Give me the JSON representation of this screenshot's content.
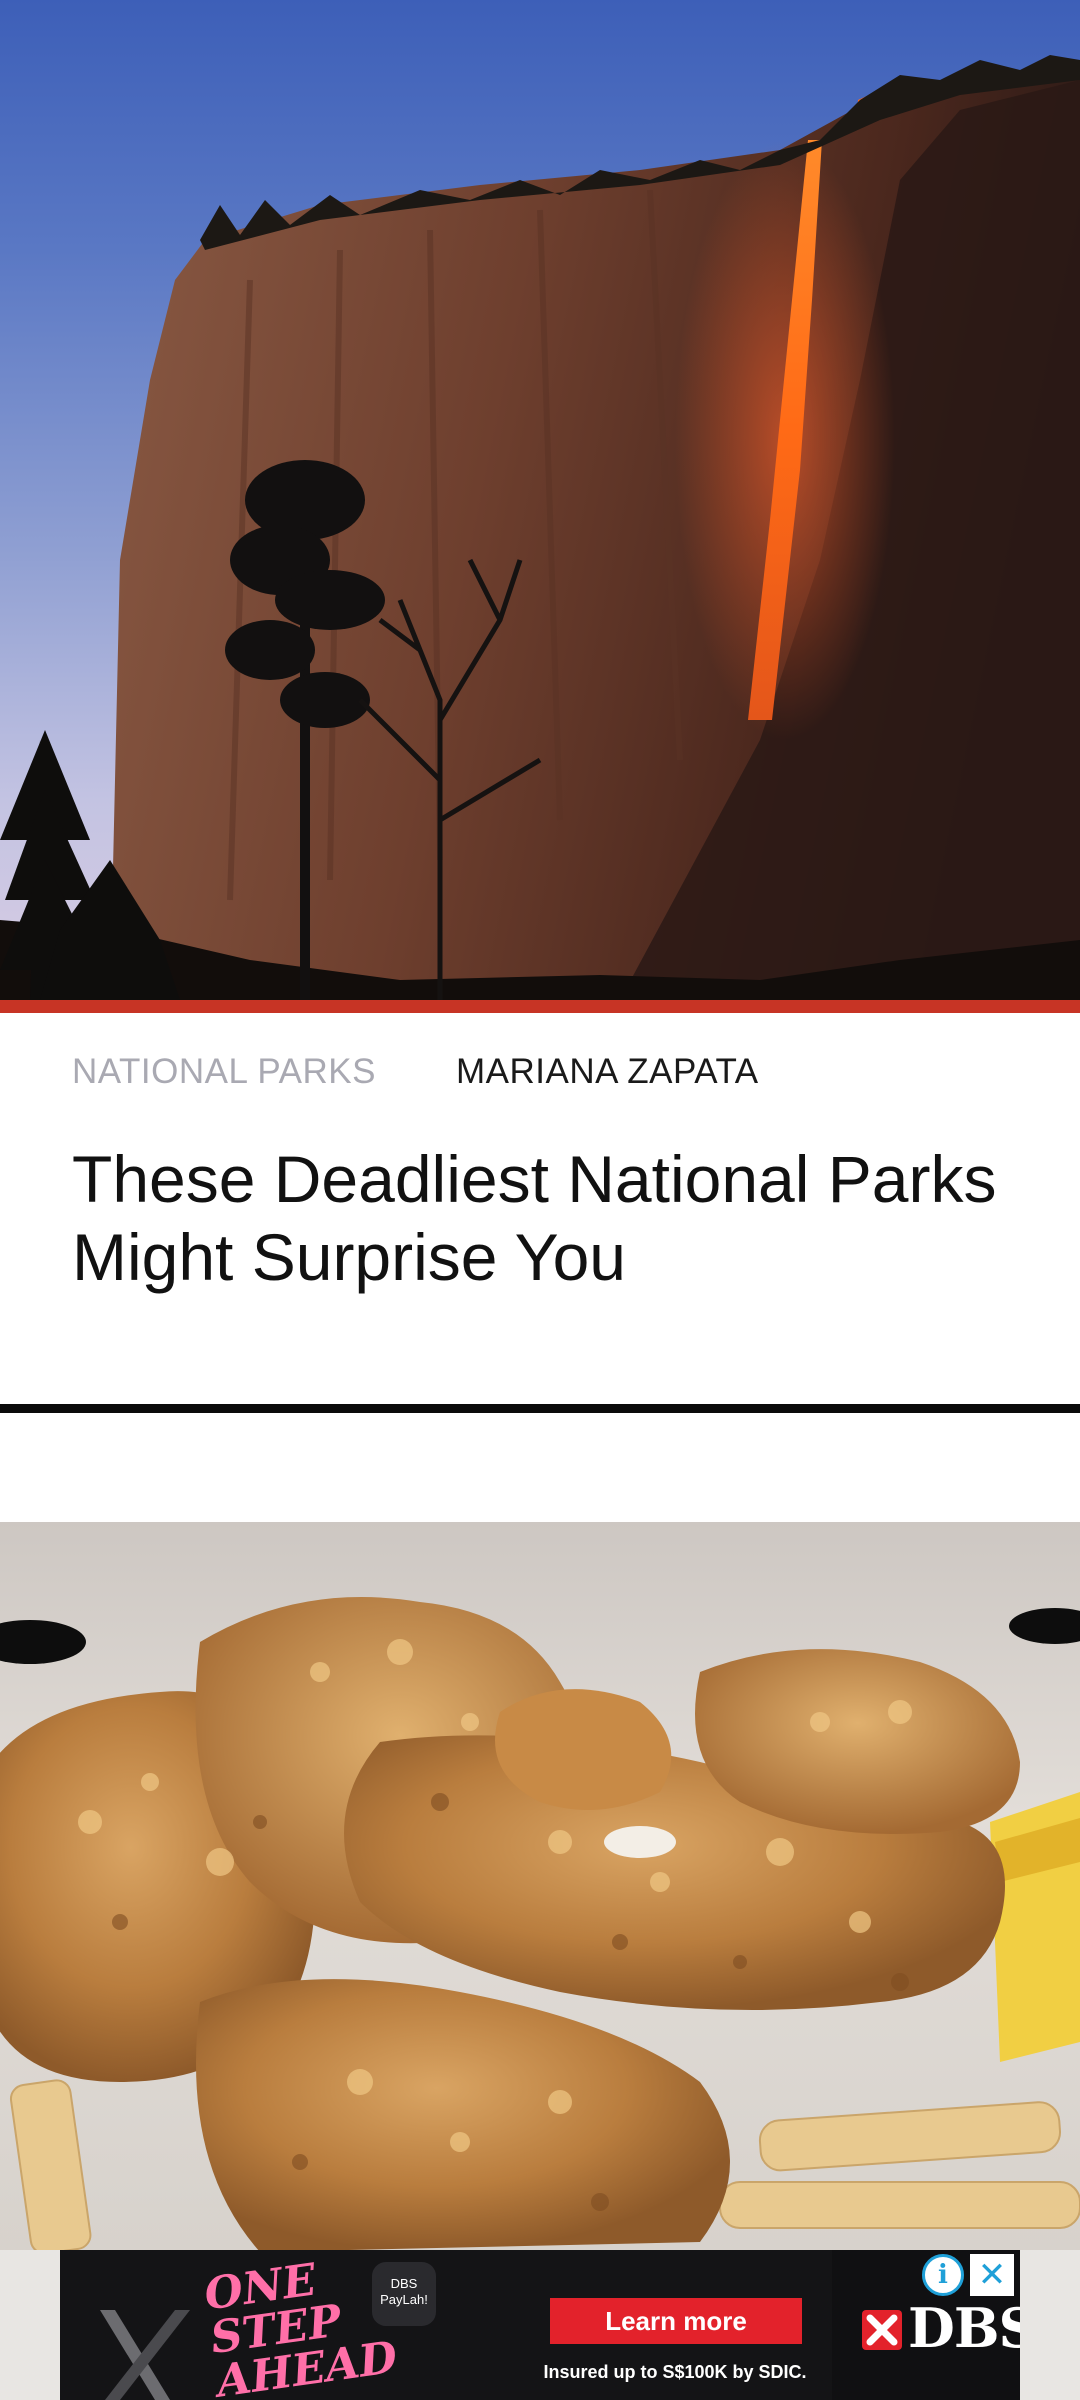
{
  "article": {
    "category": "NATIONAL PARKS",
    "author": "MARIANA ZAPATA",
    "title": "These Deadliest National Parks Might Surprise You"
  },
  "hero_image": {
    "subject": "firefall-waterfall-photo"
  },
  "next_image": {
    "subject": "fried-chicken-photo"
  },
  "ad": {
    "slogan": "ONE STEP AHEAD",
    "badge": "DBS PayLah!",
    "cta": "Learn more",
    "note": "Insured up to S$100K by SDIC.",
    "brand": "DBS",
    "info_icon": "i",
    "close_icon": "✕"
  },
  "colors": {
    "accent_bar": "#c73425",
    "category_text": "#a9a9b2",
    "divider": "#0b0b0b",
    "ad_cta": "#e3222b"
  }
}
